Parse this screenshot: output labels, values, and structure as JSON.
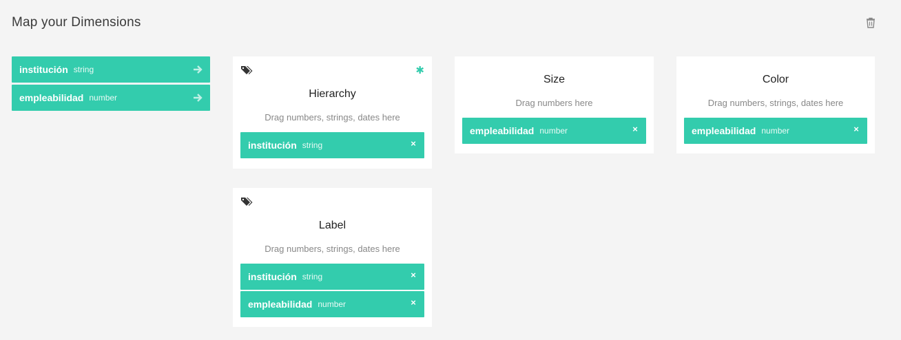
{
  "page": {
    "title": "Map your Dimensions",
    "delete_icon": "trash-icon"
  },
  "dimensions": [
    {
      "name": "institución",
      "type": "string",
      "icon": "arrow-right-icon"
    },
    {
      "name": "empleabilidad",
      "type": "number",
      "icon": "arrow-right-icon"
    }
  ],
  "cards": {
    "hierarchy": {
      "title": "Hierarchy",
      "hint": "Drag numbers, strings, dates here",
      "icon": "tags-icon",
      "required_icon": "asterisk-icon",
      "items": [
        {
          "name": "institución",
          "type": "string"
        }
      ]
    },
    "size": {
      "title": "Size",
      "hint": "Drag numbers here",
      "items": [
        {
          "name": "empleabilidad",
          "type": "number"
        }
      ]
    },
    "color": {
      "title": "Color",
      "hint": "Drag numbers, strings, dates here",
      "items": [
        {
          "name": "empleabilidad",
          "type": "number"
        }
      ]
    },
    "label": {
      "title": "Label",
      "hint": "Drag numbers, strings, dates here",
      "icon": "tags-icon",
      "items": [
        {
          "name": "institución",
          "type": "string"
        },
        {
          "name": "empleabilidad",
          "type": "number"
        }
      ]
    }
  },
  "remove_glyph": "×",
  "colors": {
    "accent": "#33ccad",
    "background": "#f4f4f4",
    "card": "#ffffff"
  }
}
